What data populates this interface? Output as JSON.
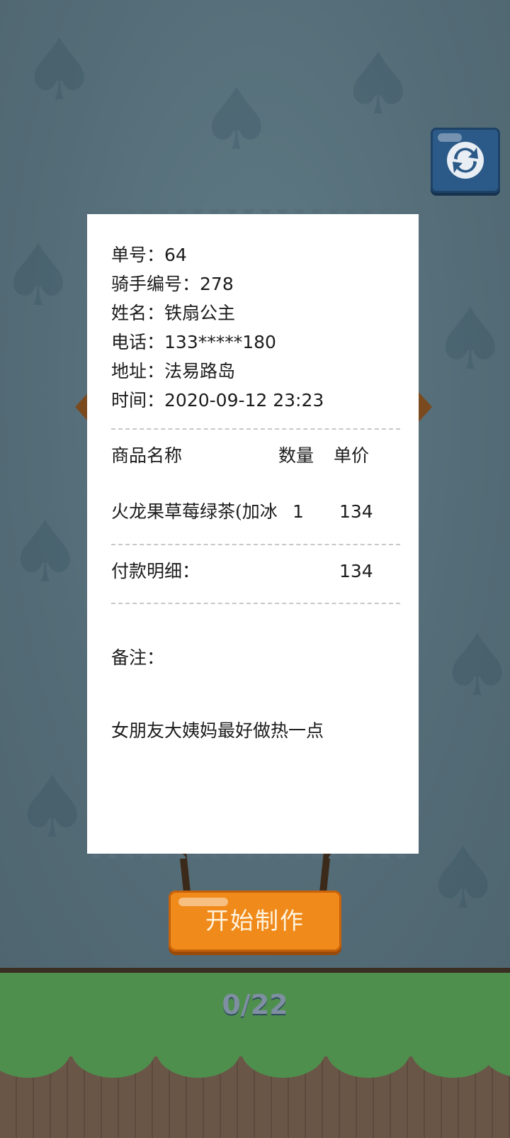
{
  "receipt": {
    "order_label": "单号：",
    "order_value": "64",
    "rider_label": "骑手编号：",
    "rider_value": "278",
    "name_label": "姓名：",
    "name_value": "铁扇公主",
    "phone_label": "电话：",
    "phone_value": "133*****180",
    "address_label": "地址：",
    "address_value": "法易路岛",
    "time_label": "时间：",
    "time_value": "2020-09-12 23:23",
    "col_item": "商品名称",
    "col_qty": "数量",
    "col_price": "单价",
    "item_name": "火龙果草莓绿茶(加冰",
    "item_qty": "1",
    "item_price": "134",
    "payment_label": "付款明细：",
    "payment_total": "134",
    "note_label": "备注：",
    "note_text": "女朋友大姨妈最好做热一点"
  },
  "start_button": {
    "label": "开始制作"
  },
  "progress": {
    "text": "0/22"
  },
  "icons": {
    "refresh": "refresh-icon"
  },
  "colors": {
    "start_button": "#f08a1a",
    "refresh_button": "#2c5a88"
  }
}
